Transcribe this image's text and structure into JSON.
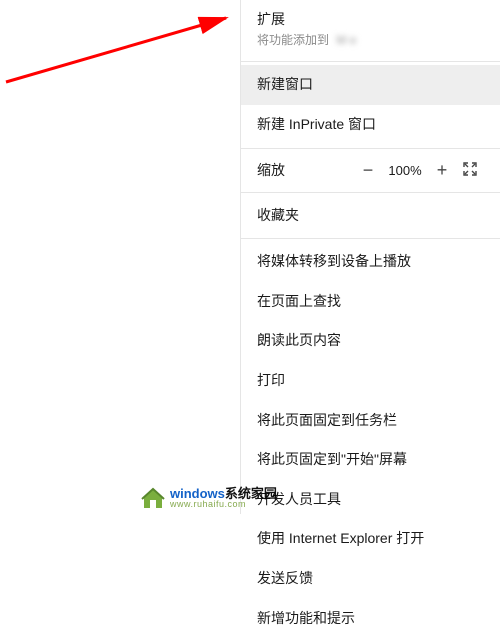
{
  "menu": {
    "extensions": {
      "title": "扩展",
      "subtitle_prefix": "将功能添加到",
      "subtitle_blurred": "M             e"
    },
    "new_window": "新建窗口",
    "new_inprivate": "新建 InPrivate 窗口",
    "zoom": {
      "label": "缩放",
      "minus": "−",
      "pct": "100%",
      "plus": "+"
    },
    "favorites": "收藏夹",
    "cast": "将媒体转移到设备上播放",
    "find": "在页面上查找",
    "read_aloud": "朗读此页内容",
    "print": "打印",
    "pin_taskbar": "将此页面固定到任务栏",
    "pin_start": "将此页固定到\"开始\"屏幕",
    "dev_tools": "开发人员工具",
    "open_ie": "使用 Internet Explorer 打开",
    "feedback": "发送反馈",
    "whats_new": "新增功能和提示"
  },
  "watermark": {
    "brand_windows": "windows",
    "brand_suffix": "系统家园",
    "url": "www.ruhaifu.com"
  }
}
